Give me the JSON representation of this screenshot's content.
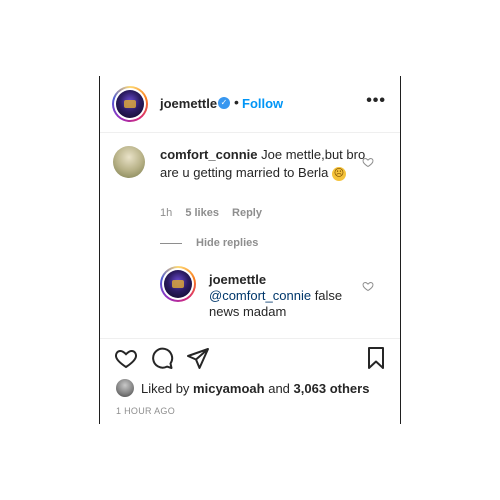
{
  "post_header": {
    "username": "joemettle",
    "separator": "•",
    "follow_label": "Follow",
    "more_label": "•••"
  },
  "comment": {
    "username": "comfort_connie",
    "text": "Joe mettle,but bro are u getting married to Berla",
    "emoji": "☹",
    "time": "1h",
    "likes": "5 likes",
    "reply_label": "Reply"
  },
  "hide_replies_label": "Hide replies",
  "reply": {
    "username": "joemettle",
    "mention": "@comfort_connie",
    "text": " false news madam"
  },
  "likes": {
    "prefix": "Liked by",
    "user": "micyamoah",
    "conjunction": "and",
    "others": "3,063 others"
  },
  "timestamp": "1 HOUR AGO",
  "icons": [
    "heart-icon",
    "comment-icon",
    "share-icon",
    "bookmark-icon",
    "verified-badge-icon"
  ],
  "colors": {
    "link": "#0095f6",
    "muted": "#8e8e8e",
    "text": "#262626",
    "verified": "#3897f0"
  }
}
